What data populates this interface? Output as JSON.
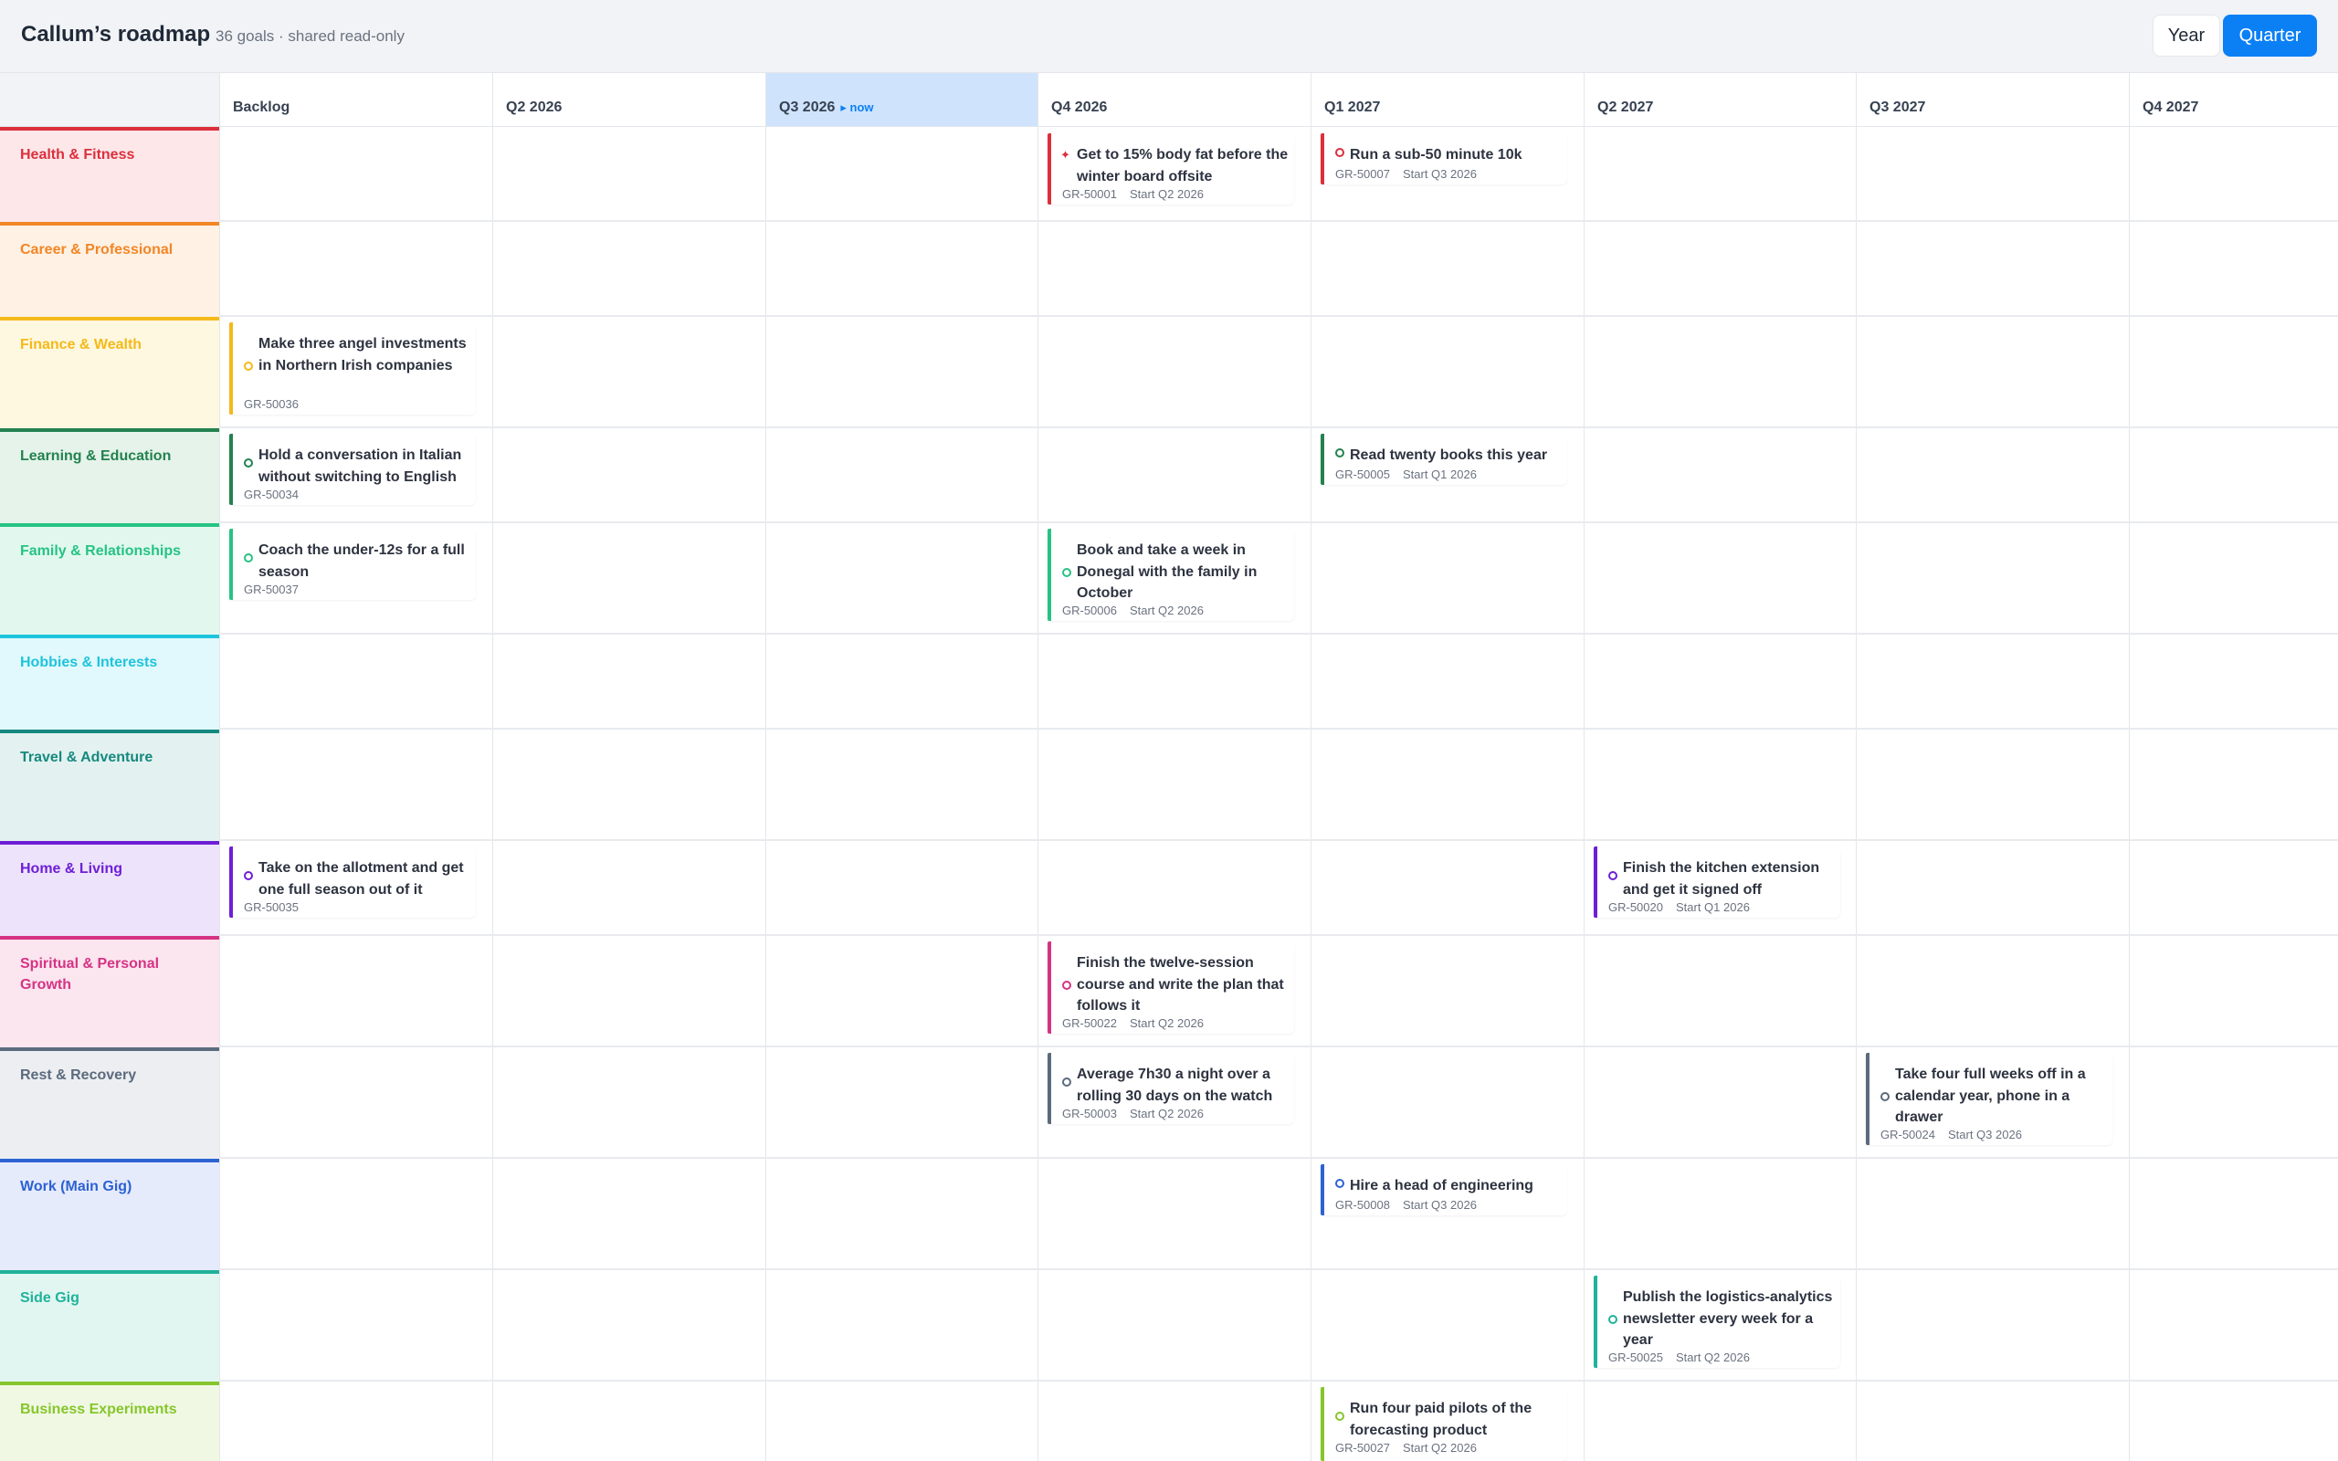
{
  "header": {
    "title": "Callum’s roadmap",
    "subtitle": "36 goals · shared read-only",
    "view_year": "Year",
    "view_quarter": "Quarter"
  },
  "columns": [
    {
      "label": "Backlog"
    },
    {
      "label": "Q2 2026"
    },
    {
      "label": "Q3 2026",
      "now_label": "▸ now"
    },
    {
      "label": "Q4 2026"
    },
    {
      "label": "Q1 2027"
    },
    {
      "label": "Q2 2027"
    },
    {
      "label": "Q3 2027"
    },
    {
      "label": "Q4 2027"
    }
  ],
  "lanes": [
    {
      "label": "Health & Fitness",
      "color": "#dc2f3c",
      "bg": "#fde7e9"
    },
    {
      "label": "Career & Professional",
      "color": "#f28627",
      "bg": "#fff1e3"
    },
    {
      "label": "Finance & Wealth",
      "color": "#f5b91a",
      "bg": "#fff8e0"
    },
    {
      "label": "Learning & Education",
      "color": "#23824f",
      "bg": "#e5f3ea"
    },
    {
      "label": "Family & Relationships",
      "color": "#26c383",
      "bg": "#e2f8ef"
    },
    {
      "label": "Hobbies & Interests",
      "color": "#1ec4dc",
      "bg": "#e1f9fc"
    },
    {
      "label": "Travel & Adventure",
      "color": "#16897f",
      "bg": "#e3f2f0"
    },
    {
      "label": "Home & Living",
      "color": "#6e1fd6",
      "bg": "#ede3fb"
    },
    {
      "label": "Spiritual & Personal Growth",
      "color": "#d63384",
      "bg": "#fbe5ef"
    },
    {
      "label": "Rest & Recovery",
      "color": "#5b6b7d",
      "bg": "#eceef1"
    },
    {
      "label": "Work (Main Gig)",
      "color": "#2d62d3",
      "bg": "#e6ebfc"
    },
    {
      "label": "Side Gig",
      "color": "#20b29a",
      "bg": "#e1f6f1"
    },
    {
      "label": "Business Experiments",
      "color": "#86c62c",
      "bg": "#f0f8e3"
    }
  ],
  "cards": [
    {
      "title": "Get to 15% body fat before the winter board offsite",
      "id": "GR-50001",
      "start": "Start Q2 2026",
      "color": "#dc2f3c",
      "icon": "star-icon"
    },
    {
      "title": "Run a sub-50 minute 10k",
      "id": "GR-50007",
      "start": "Start Q3 2026",
      "color": "#dc2f3c",
      "icon": "circle-icon"
    },
    {
      "title": "Make three angel investments in Northern Irish companies",
      "id": "GR-50036",
      "start": "",
      "color": "#f5b91a",
      "icon": "circle-icon"
    },
    {
      "title": "Hold a conversation in Italian without switching to English",
      "id": "GR-50034",
      "start": "",
      "color": "#23824f",
      "icon": "circle-icon"
    },
    {
      "title": "Read twenty books this year",
      "id": "GR-50005",
      "start": "Start Q1 2026",
      "color": "#23824f",
      "icon": "circle-icon"
    },
    {
      "title": "Coach the under-12s for a full season",
      "id": "GR-50037",
      "start": "",
      "color": "#26c383",
      "icon": "circle-icon"
    },
    {
      "title": "Book and take a week in Donegal with the family in October",
      "id": "GR-50006",
      "start": "Start Q2 2026",
      "color": "#26c383",
      "icon": "circle-icon"
    },
    {
      "title": "Take on the allotment and get one full season out of it",
      "id": "GR-50035",
      "start": "",
      "color": "#6e1fd6",
      "icon": "circle-icon"
    },
    {
      "title": "Finish the kitchen extension and get it signed off",
      "id": "GR-50020",
      "start": "Start Q1 2026",
      "color": "#6e1fd6",
      "icon": "circle-icon"
    },
    {
      "title": "Finish the twelve-session course and write the plan that follows it",
      "id": "GR-50022",
      "start": "Start Q2 2026",
      "color": "#d63384",
      "icon": "circle-icon"
    },
    {
      "title": "Average 7h30 a night over a rolling 30 days on the watch",
      "id": "GR-50003",
      "start": "Start Q2 2026",
      "color": "#5b6b7d",
      "icon": "circle-icon"
    },
    {
      "title": "Take four full weeks off in a calendar year, phone in a drawer",
      "id": "GR-50024",
      "start": "Start Q3 2026",
      "color": "#5b6b7d",
      "icon": "circle-icon"
    },
    {
      "title": "Hire a head of engineering",
      "id": "GR-50008",
      "start": "Start Q3 2026",
      "color": "#2d62d3",
      "icon": "circle-icon"
    },
    {
      "title": "Publish the logistics-analytics newsletter every week for a year",
      "id": "GR-50025",
      "start": "Start Q2 2026",
      "color": "#20b29a",
      "icon": "circle-icon"
    },
    {
      "title": "Run four paid pilots of the forecasting product",
      "id": "GR-50027",
      "start": "Start Q2 2026",
      "color": "#86c62c",
      "icon": "circle-icon"
    }
  ]
}
